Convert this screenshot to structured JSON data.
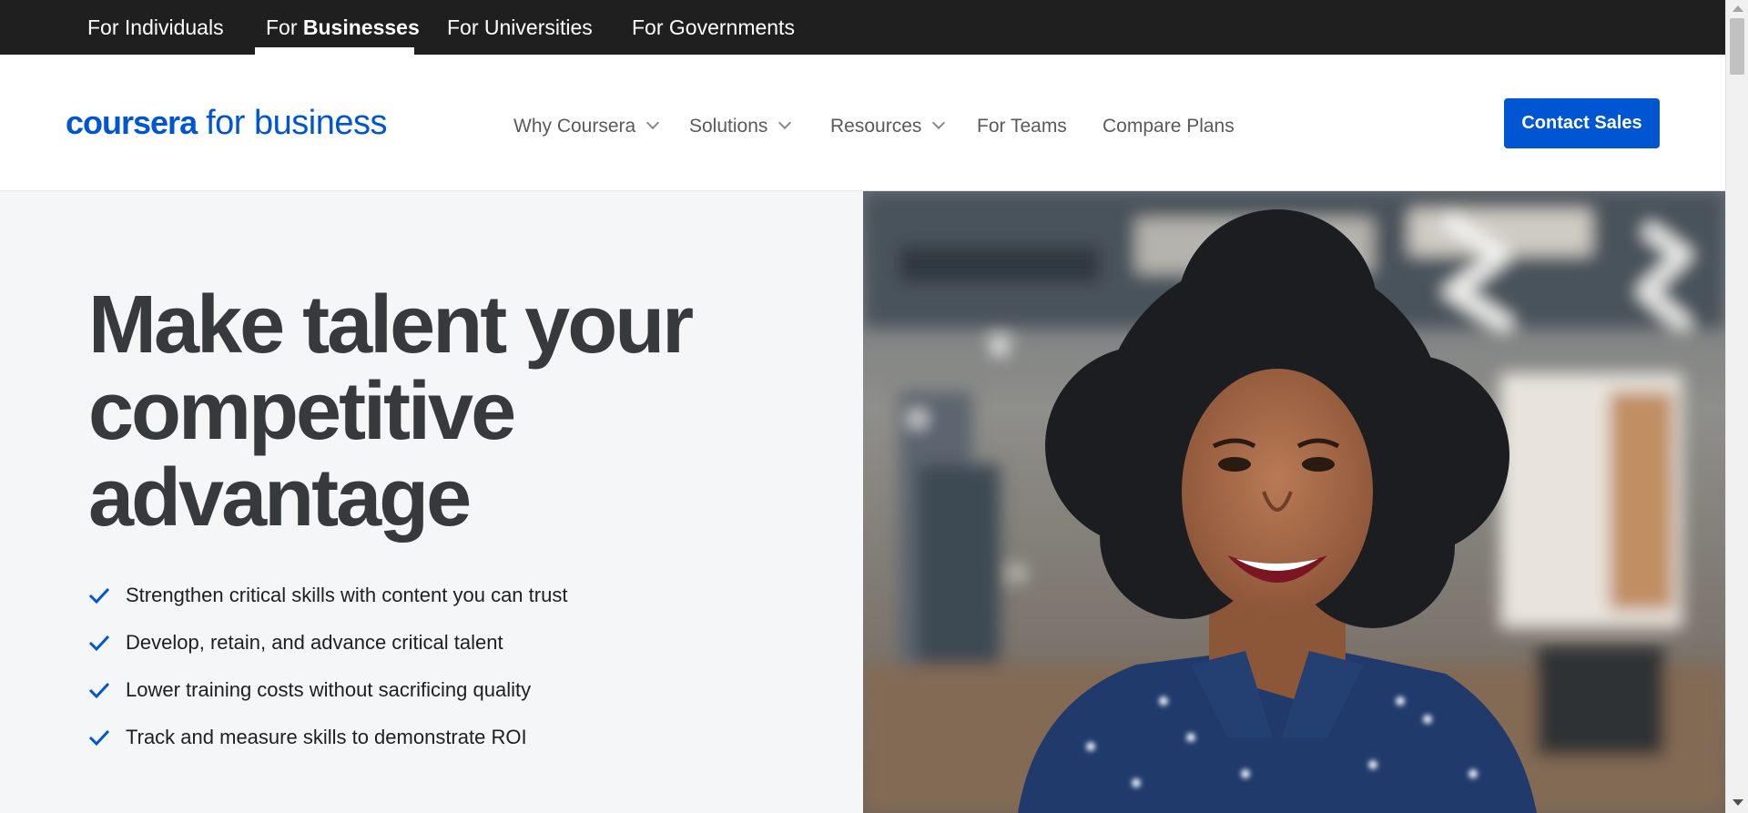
{
  "audience_tabs": [
    {
      "label": "For Individuals",
      "bold": ""
    },
    {
      "label": "For ",
      "bold": "Businesses"
    },
    {
      "label": "For Universities",
      "bold": ""
    },
    {
      "label": "For Governments",
      "bold": ""
    }
  ],
  "logo": {
    "brand": "coursera",
    "suffix": "for business"
  },
  "nav": [
    {
      "label": "Why Coursera"
    },
    {
      "label": "Solutions"
    },
    {
      "label": "Resources"
    },
    {
      "label": "For Teams"
    },
    {
      "label": "Compare Plans"
    }
  ],
  "contact_button": "Contact Sales",
  "hero": {
    "title_line1": "Make talent your",
    "title_line2": "competitive",
    "title_line3": "advantage",
    "benefits": [
      "Strengthen critical skills with content you can trust",
      "Develop, retain, and advance critical talent",
      "Lower training costs without sacrificing quality",
      "Track and measure skills to demonstrate ROI"
    ]
  },
  "colors": {
    "brand": "#0056d2",
    "topbar": "#1f1f1f",
    "hero_bg": "#f5f6f8",
    "title": "#373a3c"
  }
}
